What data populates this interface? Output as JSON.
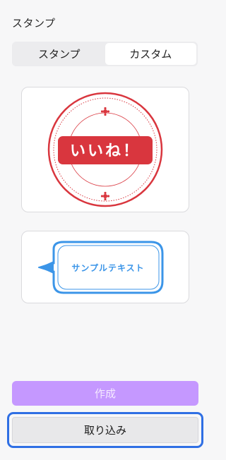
{
  "panel": {
    "title": "スタンプ"
  },
  "tabs": [
    {
      "label": "スタンプ",
      "active": false
    },
    {
      "label": "カスタム",
      "active": true
    }
  ],
  "stamps": [
    {
      "text": "いいね！",
      "color": "#d9363e"
    },
    {
      "text": "サンプルテキスト",
      "color": "#3b95e8"
    }
  ],
  "buttons": {
    "create_label": "作成",
    "import_label": "取り込み"
  },
  "colors": {
    "create_bg": "#c598ff",
    "focus_ring": "#2f6fe4"
  }
}
